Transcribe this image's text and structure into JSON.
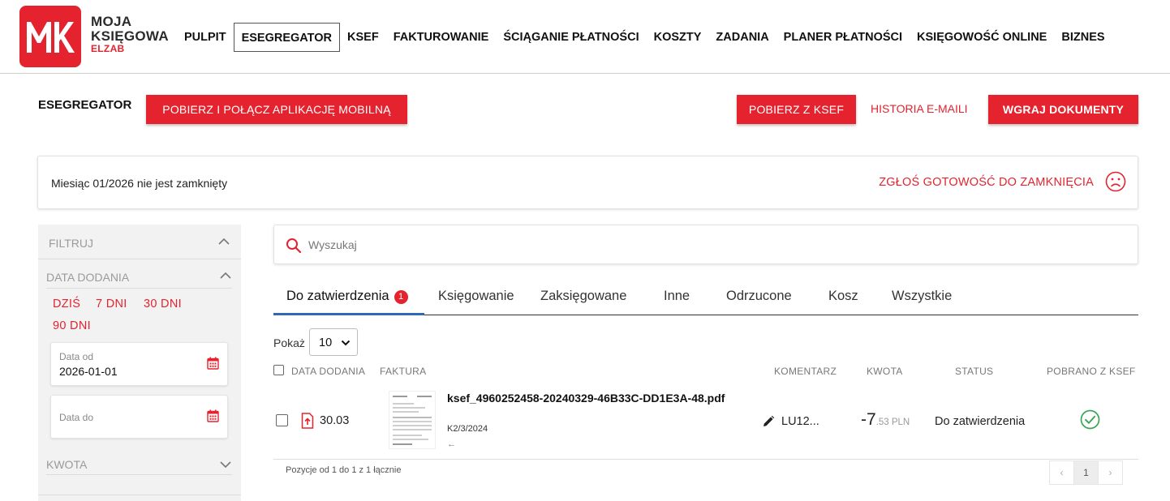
{
  "brand": {
    "line1": "MOJA",
    "line2": "KSIĘGOWA",
    "line3": "ELZAB",
    "color": "#e4232f"
  },
  "nav": [
    {
      "label": "PULPIT",
      "active": false
    },
    {
      "label": "ESEGREGATOR",
      "active": true
    },
    {
      "label": "KSEF",
      "active": false
    },
    {
      "label": "FAKTUROWANIE",
      "active": false
    },
    {
      "label": "ŚCIĄGANIE PŁATNOŚCI",
      "active": false
    },
    {
      "label": "KOSZTY",
      "active": false
    },
    {
      "label": "ZADANIA",
      "active": false
    },
    {
      "label": "PLANER PŁATNOŚCI",
      "active": false
    },
    {
      "label": "KSIĘGOWOŚĆ ONLINE",
      "active": false
    },
    {
      "label": "BIZNES",
      "active": false
    }
  ],
  "toolbar": {
    "title": "ESEGREGATOR",
    "mobile_button": "POBIERZ I POŁĄCZ APLIKACJĘ MOBILNĄ",
    "ksef_button": "POBIERZ Z KSEF",
    "email_history": "HISTORIA E-MAILI",
    "upload_button": "WGRAJ DOKUMENTY"
  },
  "month": {
    "status_text": "Miesiąc 01/2026 nie jest zamknięty",
    "action": "ZGŁOŚ GOTOWOŚĆ DO ZAMKNIĘCIA",
    "icon": "sad-face-icon"
  },
  "filter": {
    "title": "FILTRUJ",
    "date_section": "DATA DODANIA",
    "quick": [
      "DZIŚ",
      "7 DNI",
      "30 DNI",
      "90 DNI"
    ],
    "date_from": {
      "label": "Data od",
      "value": "2026-01-01"
    },
    "date_to": {
      "label": "Data do",
      "value": ""
    },
    "amount_section": "KWOTA"
  },
  "search": {
    "placeholder": "Wyszukaj"
  },
  "tabs": [
    {
      "label": "Do zatwierdzenia",
      "badge": "1",
      "active": true
    },
    {
      "label": "Księgowanie"
    },
    {
      "label": "Zaksięgowane"
    },
    {
      "label": "Inne"
    },
    {
      "label": "Odrzucone"
    },
    {
      "label": "Kosz"
    },
    {
      "label": "Wszystkie"
    }
  ],
  "page_size": {
    "label": "Pokaż",
    "value": "10"
  },
  "table": {
    "headers": {
      "date": "DATA DODANIA",
      "invoice": "FAKTURA",
      "comment": "KOMENTARZ",
      "amount": "KWOTA",
      "status": "STATUS",
      "ksef": "POBRANO Z KSEF"
    },
    "rows": [
      {
        "date": "30.03",
        "file": "ksef_4960252458-20240329-46B33C-DD1E3A-48.pdf",
        "number": "K2/3/2024",
        "extra": "←",
        "comment": "LU12...",
        "amount_int": "-7",
        "amount_dec": ".53 PLN",
        "status": "Do zatwierdzenia",
        "ksef_downloaded": true
      }
    ]
  },
  "pager": {
    "info": "Pozycje od 1 do 1 z 1 łącznie",
    "prev": "‹",
    "current": "1",
    "next": "›"
  },
  "colors": {
    "accent": "#e4232f",
    "tab_underline": "#2f69b3",
    "success": "#3aa655"
  }
}
